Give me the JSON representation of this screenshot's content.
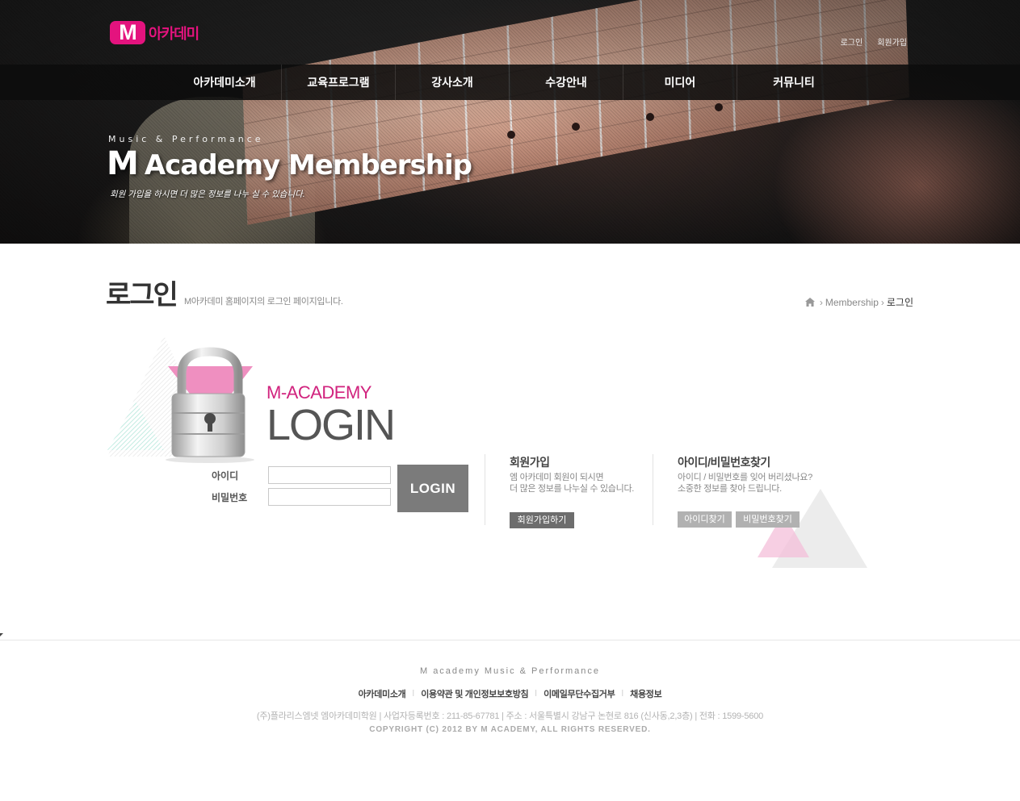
{
  "header": {
    "logo_mark": "M",
    "logo_text": "아카데미",
    "util_links": {
      "login": "로그인",
      "join": "회원가입"
    },
    "nav": [
      "아카데미소개",
      "교육프로그램",
      "강사소개",
      "수강안내",
      "미디어",
      "커뮤니티"
    ],
    "tagline": "Music & Performance",
    "hero_title_mark": "M",
    "hero_title": "Academy Membership",
    "hero_subtitle": "회원 가입을 하시면 더 많은 정보를 나누 실 수 있습니다."
  },
  "page": {
    "title": "로그인",
    "description": "M아카데미 홈페이지의 로그인 페이지입니다.",
    "breadcrumb": [
      "Membership",
      "로그인"
    ]
  },
  "login": {
    "brand_sub": "M-ACADEMY",
    "brand_main": "LOGIN",
    "id_label": "아이디",
    "pw_label": "비밀번호",
    "id_value": "",
    "pw_value": "",
    "button": "LOGIN"
  },
  "join_box": {
    "title": "회원가입",
    "line1": "엠 아카데미 회원이 되시면",
    "line2": "더 많은 정보를 나누실 수 있습니다.",
    "button": "회원가입하기"
  },
  "find_box": {
    "title": "아이디/비밀번호찾기",
    "line1": "아이디 / 비밀번호를 잊어 버리셨나요?",
    "line2": "소중한 정보를 찾아 드립니다.",
    "find_id_button": "아이디찾기",
    "find_pw_button": "비밀번호찾기"
  },
  "footer": {
    "brand": "M academy Music & Performance",
    "links": [
      "아카데미소개",
      "이용약관 및 개인정보보호방침",
      "이메일무단수집거부",
      "채용정보"
    ],
    "address": "(주)플라리스엠넷 엠아카데미학원 | 사업자등록번호 : 211-85-67781 | 주소 : 서울특별시 강남구 논현로 816 (신사동,2,3층) | 전화 : 1599-5600",
    "copyright": "COPYRIGHT (C) 2012 BY M ACADEMY, ALL RIGHTS RESERVED."
  },
  "colors": {
    "brand_pink": "#e4137e",
    "login_button": "#7b7b7b",
    "join_button": "#6d6d6d",
    "find_button": "#b1b1b1"
  }
}
